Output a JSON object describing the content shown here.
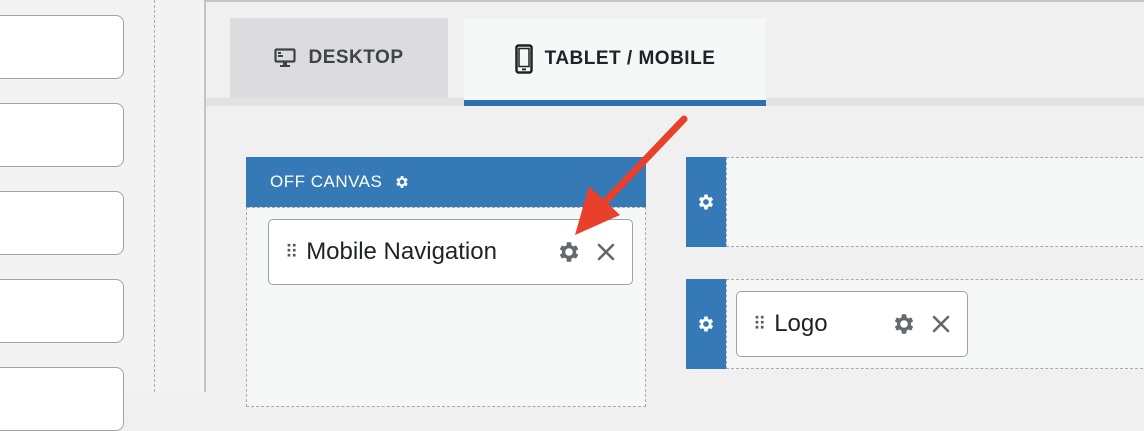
{
  "tabs": {
    "desktop_label": "DESKTOP",
    "mobile_label": "TABLET / MOBILE",
    "active": "TABLET / MOBILE"
  },
  "off_canvas": {
    "title": "OFF CANVAS",
    "items": [
      {
        "label": "Mobile Navigation"
      }
    ]
  },
  "rows": [
    {
      "items": []
    },
    {
      "items": [
        {
          "label": "Logo"
        }
      ]
    }
  ],
  "icons": {
    "desktop": "desktop-monitor-icon",
    "mobile": "smartphone-icon",
    "settings": "gear-icon",
    "remove": "close-icon",
    "drag": "drag-handle-icon",
    "annotation": "red-arrow-icon"
  },
  "colors": {
    "accent": "#3579b6",
    "arrow": "#e8402a",
    "active_tab_underline": "#2d6fb1"
  }
}
